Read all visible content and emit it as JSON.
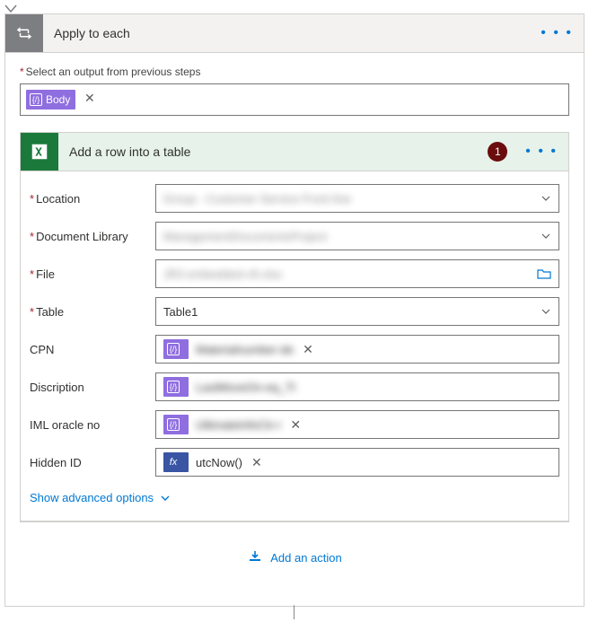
{
  "outer": {
    "title": "Apply to each",
    "menu": "• • •",
    "prev_label": "Select an output from previous steps",
    "body_token": "Body"
  },
  "inner": {
    "title": "Add a row into a table",
    "badge": "1",
    "menu": "• • •"
  },
  "fields": {
    "location": {
      "label": "Location",
      "value": "Group - Customer Service Front line"
    },
    "doclib": {
      "label": "Document Library",
      "value": "ManagementDocumentsProject"
    },
    "file": {
      "label": "File",
      "value": "JR3 embedded-cft.xlsx"
    },
    "table": {
      "label": "Table",
      "value": "Table1"
    },
    "cpn": {
      "label": "CPN",
      "token": "Materialnumber-de"
    },
    "disc": {
      "label": "Discription",
      "token": "LastMoveOn-eq_TI"
    },
    "iml": {
      "label": "IML oracle no",
      "token": "UltimateInfoCtr-r"
    },
    "hidden": {
      "label": "Hidden ID",
      "token": "utcNow()"
    }
  },
  "advanced": "Show advanced options",
  "add_action": "Add an action"
}
